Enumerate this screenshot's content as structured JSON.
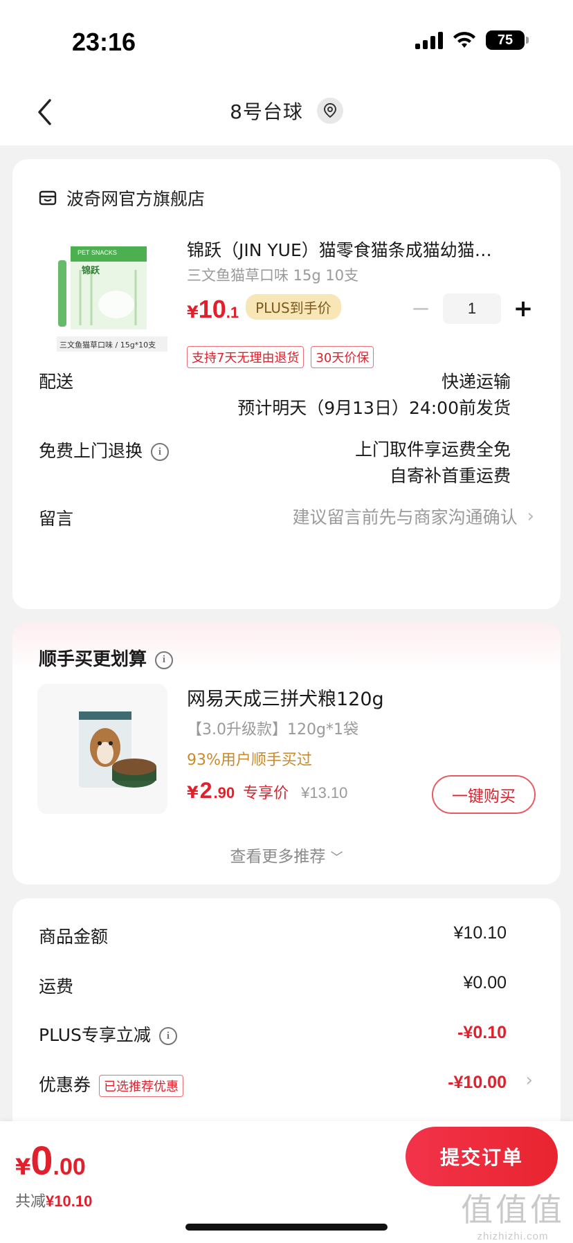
{
  "status": {
    "time": "23:16",
    "battery": "75"
  },
  "nav": {
    "title": "8号台球"
  },
  "store": {
    "name": "波奇网官方旗舰店"
  },
  "product": {
    "title": "锦跃（JIN YUE）猫零食猫条成猫幼猫…",
    "spec": "三文鱼猫草口味 15g 10支",
    "price_symbol": "¥",
    "price_int": "10",
    "price_dec": ".1",
    "plus_tag": "PLUS到手价",
    "qty": "1",
    "tags": [
      "支持7天无理由退货",
      "30天价保"
    ],
    "img_brand": "PET SNACKS",
    "img_logo": "锦跃",
    "img_caption": "三文鱼猫草口味 / 15g*10支"
  },
  "delivery": {
    "label": "配送",
    "method": "快递运输",
    "eta": "预计明天（9月13日）24:00前发货"
  },
  "returns": {
    "label": "免费上门退换",
    "line1": "上门取件享运费全免",
    "line2": "自寄补首重运费"
  },
  "message": {
    "label": "留言",
    "placeholder": "建议留言前先与商家沟通确认"
  },
  "upsell": {
    "title": "顺手买更划算",
    "name": "网易天成三拼犬粮120g",
    "spec": "【3.0升级款】120g*1袋",
    "buyers": "93%用户顺手买过",
    "price_symbol": "¥",
    "price_int": "2",
    "price_dec": ".90",
    "price_label": "专享价",
    "orig_price": "¥13.10",
    "buy_label": "一键购买",
    "more": "查看更多推荐"
  },
  "summary": {
    "goods_label": "商品金额",
    "goods_val": "¥10.10",
    "ship_label": "运费",
    "ship_val": "¥0.00",
    "plus_label": "PLUS专享立减",
    "plus_val": "-¥0.10",
    "coupon_label": "优惠券",
    "coupon_tag": "已选推荐优惠",
    "coupon_val": "-¥10.00"
  },
  "bottom": {
    "total_symbol": "¥",
    "total_int": "0",
    "total_dec": ".00",
    "saved_label": "共减",
    "saved_amt": "¥10.10",
    "submit": "提交订单"
  },
  "watermark": {
    "big": "值值值",
    "small": "zhizhizhi.com"
  },
  "colors": {
    "accent_red": "#e0202c",
    "plus_gold": "#f8e6b6",
    "buyers_orange": "#c98a2a"
  }
}
